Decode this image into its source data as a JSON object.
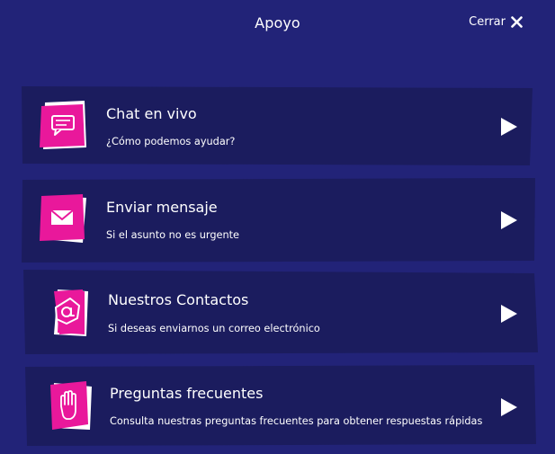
{
  "header": {
    "title": "Apoyo",
    "close_label": "Cerrar",
    "close_icon": "close-x-icon"
  },
  "options": [
    {
      "title": "Chat en vivo",
      "subtitle": "¿Cómo podemos ayudar?",
      "icon": "chat-bubble-icon"
    },
    {
      "title": "Enviar mensaje",
      "subtitle": "Si el asunto no es urgente",
      "icon": "envelope-icon"
    },
    {
      "title": "Nuestros Contactos",
      "subtitle": "Si deseas enviarnos un correo electrónico",
      "icon": "at-sign-icon"
    },
    {
      "title": "Preguntas frecuentes",
      "subtitle": "Consulta nuestras preguntas frecuentes para obtener respuestas rápidas",
      "icon": "hand-icon"
    }
  ],
  "colors": {
    "background": "#222378",
    "card": "#1b1c5e",
    "accent": "#e9189b",
    "text": "#ffffff"
  }
}
